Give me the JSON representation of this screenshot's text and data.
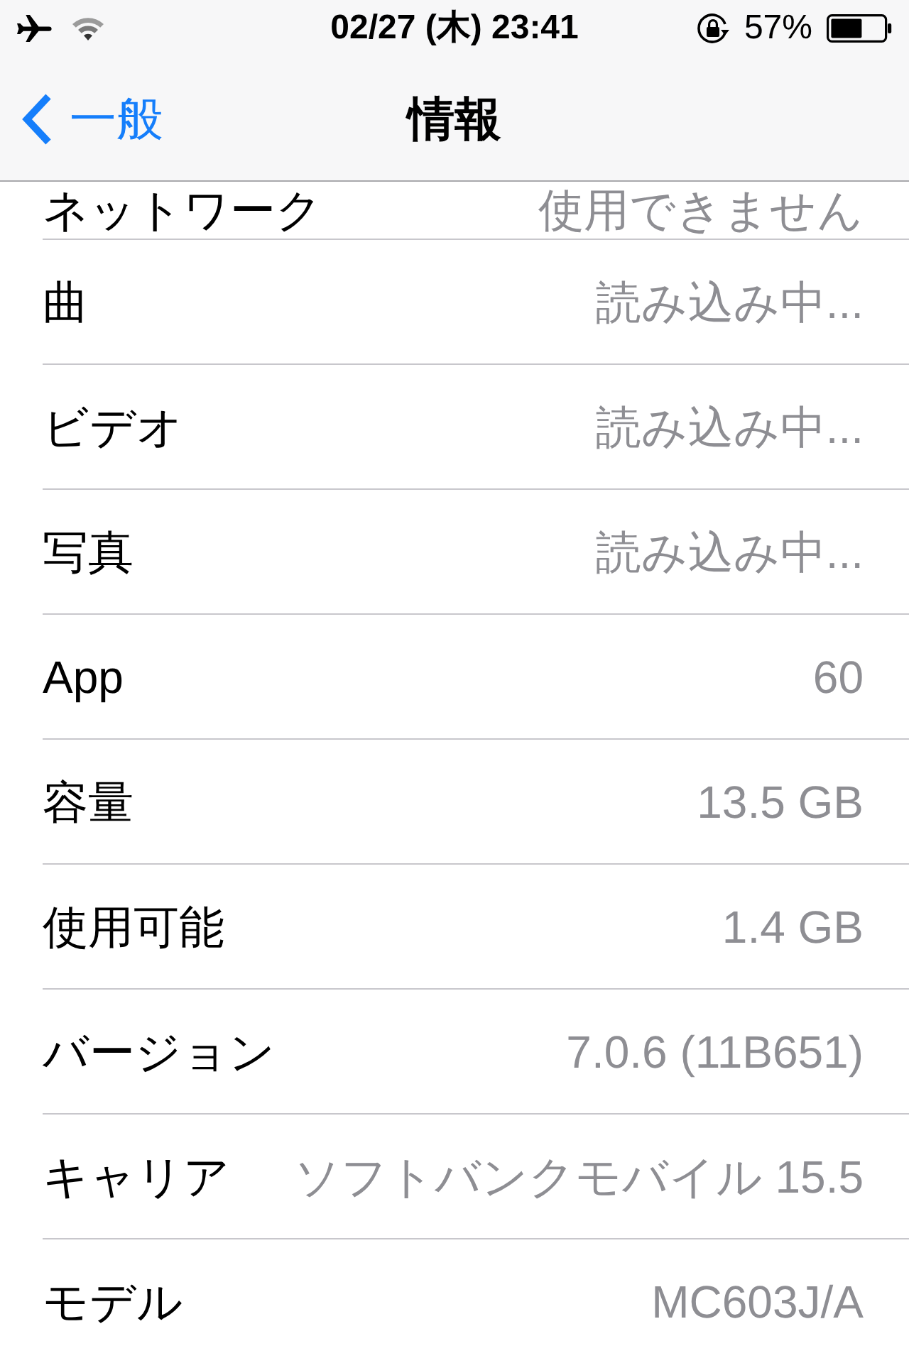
{
  "status_bar": {
    "time": "02/27 (木) 23:41",
    "battery_percent": "57%"
  },
  "nav": {
    "back": "一般",
    "title": "情報"
  },
  "rows": [
    {
      "label": "ネットワーク",
      "value": "使用できません"
    },
    {
      "label": "曲",
      "value": "読み込み中..."
    },
    {
      "label": "ビデオ",
      "value": "読み込み中..."
    },
    {
      "label": "写真",
      "value": "読み込み中..."
    },
    {
      "label": "App",
      "value": "60"
    },
    {
      "label": "容量",
      "value": "13.5 GB"
    },
    {
      "label": "使用可能",
      "value": "1.4 GB"
    },
    {
      "label": "バージョン",
      "value": "7.0.6 (11B651)"
    },
    {
      "label": "キャリア",
      "value": "ソフトバンクモバイル 15.5"
    },
    {
      "label": "モデル",
      "value": "MC603J/A"
    }
  ]
}
